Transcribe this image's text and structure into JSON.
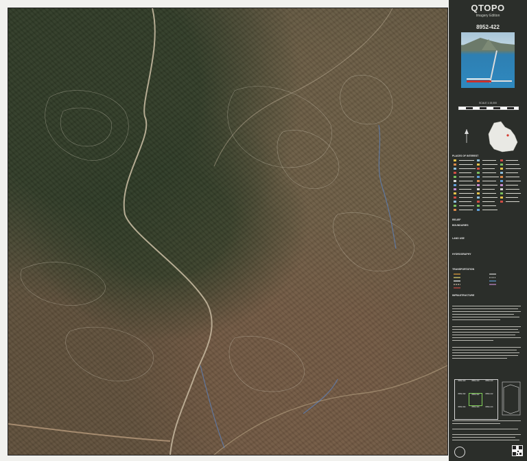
{
  "header": {
    "title": "QTOPO",
    "subtitle": "Imagery Edition",
    "sheet_number": "8952-422"
  },
  "scale": {
    "label": "SCALE 1:15,000"
  },
  "legend": {
    "sections": [
      {
        "title": "PLACES OF INTEREST"
      },
      {
        "title": "RELIEF"
      },
      {
        "title": "BOUNDARIES"
      },
      {
        "title": "LAND USE"
      },
      {
        "title": "HYDROGRAPHY"
      },
      {
        "title": "TRANSPORTATION"
      },
      {
        "title": "INFRASTRUCTURE"
      }
    ]
  },
  "index": {
    "sheets": [
      [
        "8952-423",
        "8952-413",
        "8952-143"
      ],
      [
        "8952-432",
        "8952-422",
        "8952-142"
      ],
      [
        "8952-434",
        "8952-424",
        "8952-144"
      ]
    ]
  },
  "colors": {
    "panel_bg": "#2b2e2a",
    "frame_border": "#1f1f1f",
    "track": "#cdbfa6",
    "current_sheet": "#84d45a",
    "water": "#5b84c6"
  },
  "icons": {
    "logo": "queensland-government-crest-icon",
    "qr": "qr-code-icon"
  }
}
